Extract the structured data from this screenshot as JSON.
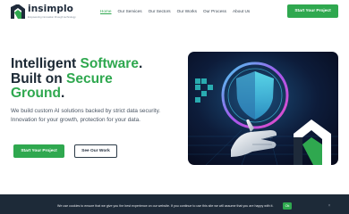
{
  "brand": {
    "name": "insimplo",
    "tagline": "Empowering innovation through technology",
    "accent_color": "#2fa84f",
    "dark_color": "#1d2a38"
  },
  "nav": {
    "items": [
      {
        "label": "Home",
        "active": true
      },
      {
        "label": "Our Services",
        "active": false
      },
      {
        "label": "Our Sectors",
        "active": false
      },
      {
        "label": "Our Works",
        "active": false
      },
      {
        "label": "Our Process",
        "active": false
      },
      {
        "label": "About Us",
        "active": false
      }
    ],
    "cta_label": "Start Your Project"
  },
  "hero": {
    "title_line1_a": "Intelligent ",
    "title_line1_b": "Software",
    "title_line1_c": ".",
    "title_line2_a": "Built on ",
    "title_line2_b": "Secure",
    "title_line3_a": "Ground",
    "title_line3_b": ".",
    "subtitle": "We build custom AI solutions backed by strict data security. Innovation for your growth, protection for your data.",
    "primary_button": "Start Your Project",
    "secondary_button": "See Our Work",
    "image_icons": [
      "shield-lock-icon",
      "robot-hand",
      "insimplo-logo-mark"
    ]
  },
  "cookie": {
    "text": "We use cookies to ensure that we give you the best experience on our website. If you continue to use this site we will assume that you are happy with it.",
    "ok_label": "Ok",
    "close_label": "×"
  }
}
